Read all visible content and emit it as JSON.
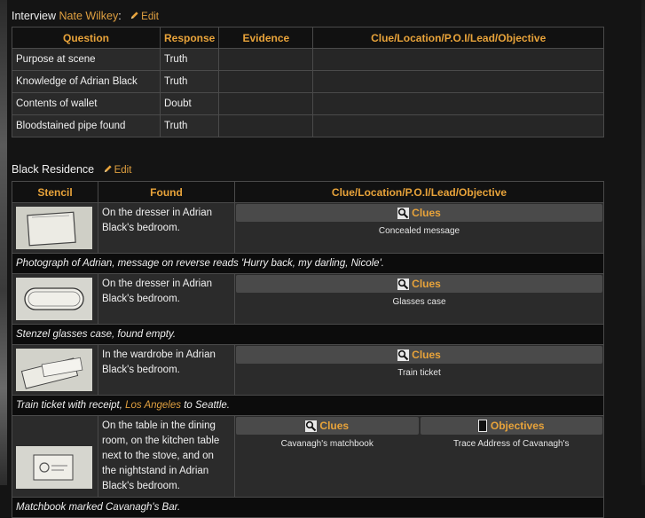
{
  "interview": {
    "prefix": "Interview",
    "name": "Nate Wilkey",
    "colon": ":",
    "edit_label": "Edit",
    "headers": [
      "Question",
      "Response",
      "Evidence",
      "Clue/Location/P.O.I/Lead/Objective"
    ],
    "rows": [
      {
        "question": "Purpose at scene",
        "response": "Truth"
      },
      {
        "question": "Knowledge of Adrian Black",
        "response": "Truth"
      },
      {
        "question": "Contents of wallet",
        "response": "Doubt"
      },
      {
        "question": "Bloodstained pipe found",
        "response": "Truth"
      }
    ]
  },
  "residence": {
    "title": "Black Residence",
    "edit_label": "Edit",
    "headers": [
      "Stencil",
      "Found",
      "Clue/Location/P.O.I/Lead/Objective"
    ],
    "items": [
      {
        "found": "On the dresser in Adrian Black's bedroom.",
        "clue_label": "Clues",
        "clue_text": "Concealed message",
        "desc": "Photograph of Adrian, message on reverse reads 'Hurry back, my darling, Nicole'."
      },
      {
        "found": "On the dresser in Adrian Black's bedroom.",
        "clue_label": "Clues",
        "clue_text": "Glasses case",
        "desc": "Stenzel glasses case, found empty."
      },
      {
        "found": "In the wardrobe in Adrian Black's bedroom.",
        "clue_label": "Clues",
        "clue_text": "Train ticket",
        "desc_pre": "Train ticket with receipt,",
        "desc_link": "Los Angeles",
        "desc_post": "to Seattle."
      },
      {
        "found": "On the table in the dining room, on the kitchen table next to the stove, and on the nightstand in Adrian Black's bedroom.",
        "clue_label": "Clues",
        "clue_text": "Cavanagh's matchbook",
        "obj_label": "Objectives",
        "obj_text": "Trace Address of Cavanagh's",
        "desc": "Matchbook marked Cavanagh's Bar."
      }
    ]
  },
  "colors": {
    "accent": "#e8a33a",
    "background": "#141414",
    "row": "#2a2a2a"
  }
}
